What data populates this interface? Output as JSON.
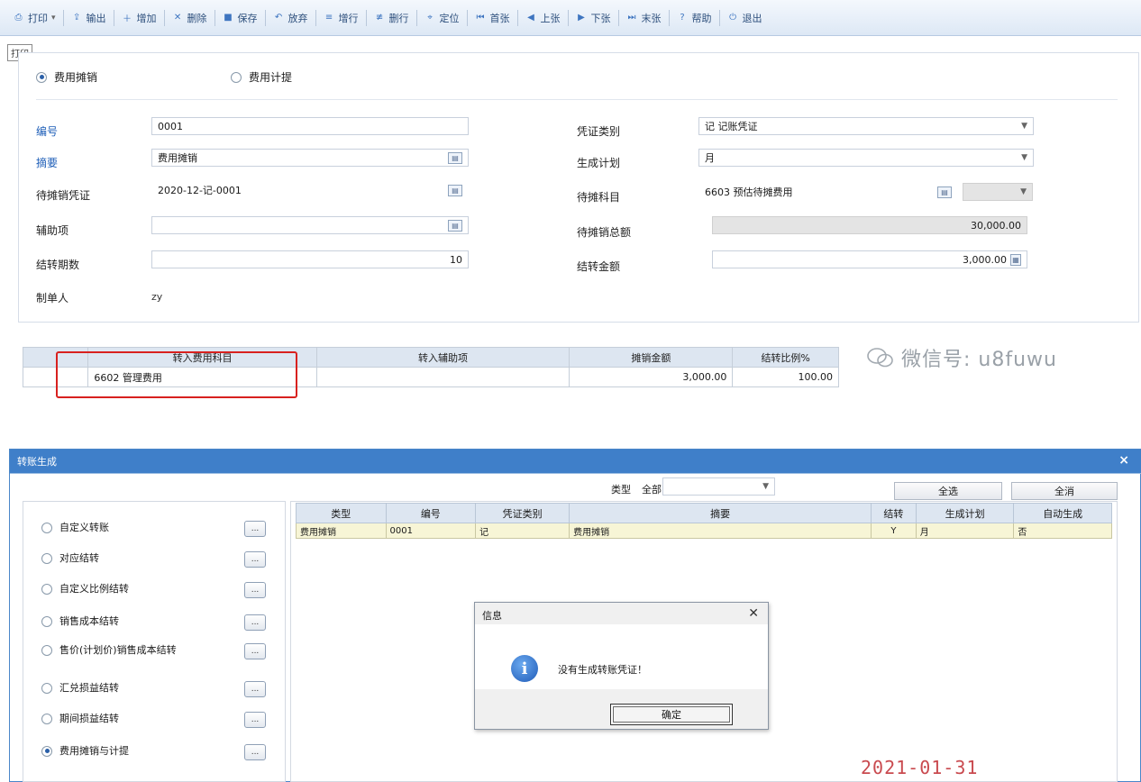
{
  "toolbar": {
    "items": [
      {
        "label": "打印",
        "icon": "printer-icon"
      },
      {
        "label": "输出",
        "icon": "export-icon"
      },
      {
        "label": "增加",
        "icon": "add-icon"
      },
      {
        "label": "删除",
        "icon": "delete-icon"
      },
      {
        "label": "保存",
        "icon": "save-icon"
      },
      {
        "label": "放弃",
        "icon": "discard-icon"
      },
      {
        "label": "增行",
        "icon": "add-row-icon"
      },
      {
        "label": "删行",
        "icon": "delete-row-icon"
      },
      {
        "label": "定位",
        "icon": "locate-icon"
      },
      {
        "label": "首张",
        "icon": "first-icon"
      },
      {
        "label": "上张",
        "icon": "prev-icon"
      },
      {
        "label": "下张",
        "icon": "next-icon"
      },
      {
        "label": "末张",
        "icon": "last-icon"
      },
      {
        "label": "帮助",
        "icon": "help-icon"
      },
      {
        "label": "退出",
        "icon": "exit-icon"
      }
    ]
  },
  "print_tag": "打印",
  "form": {
    "radio_amortize": "费用摊销",
    "radio_accrue": "费用计提",
    "left": [
      {
        "label": "编号",
        "value": "0001",
        "blue": true,
        "icon": false
      },
      {
        "label": "摘要",
        "value": "费用摊销",
        "blue": true,
        "icon": true
      },
      {
        "label": "待摊销凭证",
        "value": "2020-12-记-0001",
        "blue": false,
        "icon": true
      },
      {
        "label": "辅助项",
        "value": "",
        "blue": false,
        "icon": true
      },
      {
        "label": "结转期数",
        "value": "10",
        "blue": false,
        "icon": false
      }
    ],
    "operator_label": "制单人",
    "operator_value": "zy",
    "right": [
      {
        "label": "凭证类别",
        "value": "记 记账凭证"
      },
      {
        "label": "生成计划",
        "value": "月"
      },
      {
        "label": "待摊科目",
        "value": "6603 预估待摊费用"
      },
      {
        "label": "待摊销总额",
        "value": "30,000.00"
      },
      {
        "label": "结转金额",
        "value": "3,000.00"
      }
    ]
  },
  "grid1": {
    "headers": [
      "转入费用科目",
      "转入辅助项",
      "摊销金额",
      "结转比例%"
    ],
    "rows": [
      [
        "6602 管理费用",
        "",
        "3,000.00",
        "100.00"
      ]
    ]
  },
  "watermark": "微信号: u8fuwu",
  "dialog": {
    "title": "转账生成",
    "close": "×",
    "type_label": "类型",
    "type_value": "全部",
    "select_all": "全选",
    "deselect": "全消",
    "list": [
      {
        "label": "自定义转账",
        "on": false
      },
      {
        "label": "对应结转",
        "on": false
      },
      {
        "label": "自定义比例结转",
        "on": false
      },
      {
        "label": "销售成本结转",
        "on": false
      },
      {
        "label": "售价(计划价)销售成本结转",
        "on": false
      },
      {
        "label": "汇兑损益结转",
        "on": false
      },
      {
        "label": "期间损益结转",
        "on": false
      },
      {
        "label": "费用摊销与计提",
        "on": true
      }
    ],
    "list_btn": "...",
    "grid": {
      "headers": [
        "类型",
        "编号",
        "凭证类别",
        "摘要",
        "结转",
        "生成计划",
        "自动生成"
      ],
      "rows": [
        [
          "费用摊销",
          "0001",
          "记",
          "费用摊销",
          "Y",
          "月",
          "否"
        ]
      ]
    }
  },
  "message": {
    "title": "信息",
    "close": "✕",
    "text": "没有生成转账凭证！",
    "ok": "确定"
  },
  "date_stamp": "2021-01-31"
}
